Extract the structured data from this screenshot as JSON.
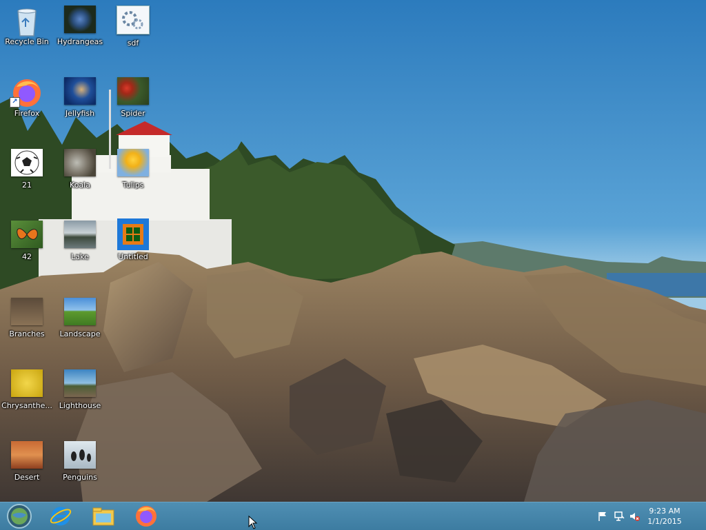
{
  "desktop": {
    "icons": [
      {
        "label": "Recycle Bin",
        "icon": "recycle-bin-icon"
      },
      {
        "label": "Hydrangeas",
        "icon": "image-thumbnail-hydrangeas"
      },
      {
        "label": "sdf",
        "icon": "settings-file-icon"
      },
      {
        "label": "Firefox",
        "icon": "firefox-icon"
      },
      {
        "label": "Jellyfish",
        "icon": "image-thumbnail-jellyfish"
      },
      {
        "label": "Spider",
        "icon": "image-thumbnail-spider"
      },
      {
        "label": "21",
        "icon": "soccer-ball-icon"
      },
      {
        "label": "Koala",
        "icon": "image-thumbnail-koala"
      },
      {
        "label": "Tulips",
        "icon": "image-thumbnail-tulips"
      },
      {
        "label": "42",
        "icon": "image-thumbnail-butterfly"
      },
      {
        "label": "Lake",
        "icon": "image-thumbnail-lake"
      },
      {
        "label": "Untitled",
        "icon": "image-thumbnail-untitled"
      },
      {
        "label": "Branches",
        "icon": "image-thumbnail-branches"
      },
      {
        "label": "Landscape",
        "icon": "image-thumbnail-landscape"
      },
      {
        "label": "Chrysanthe...",
        "icon": "image-thumbnail-chrysanthemum"
      },
      {
        "label": "Lighthouse",
        "icon": "image-thumbnail-lighthouse"
      },
      {
        "label": "Desert",
        "icon": "image-thumbnail-desert"
      },
      {
        "label": "Penguins",
        "icon": "image-thumbnail-penguins"
      }
    ]
  },
  "taskbar": {
    "pinned": [
      {
        "icon": "start-orb-icon"
      },
      {
        "icon": "internet-explorer-icon"
      },
      {
        "icon": "file-explorer-icon"
      },
      {
        "icon": "firefox-icon"
      }
    ],
    "tray": {
      "icons": [
        "action-center-flag-icon",
        "network-icon",
        "volume-muted-icon"
      ],
      "time": "9:23 AM",
      "date": "1/1/2015"
    }
  },
  "colors": {
    "taskbar": "#4485ab",
    "sky": "#3b88c6",
    "rock": "#7a6650",
    "trees": "#2d4a23"
  }
}
